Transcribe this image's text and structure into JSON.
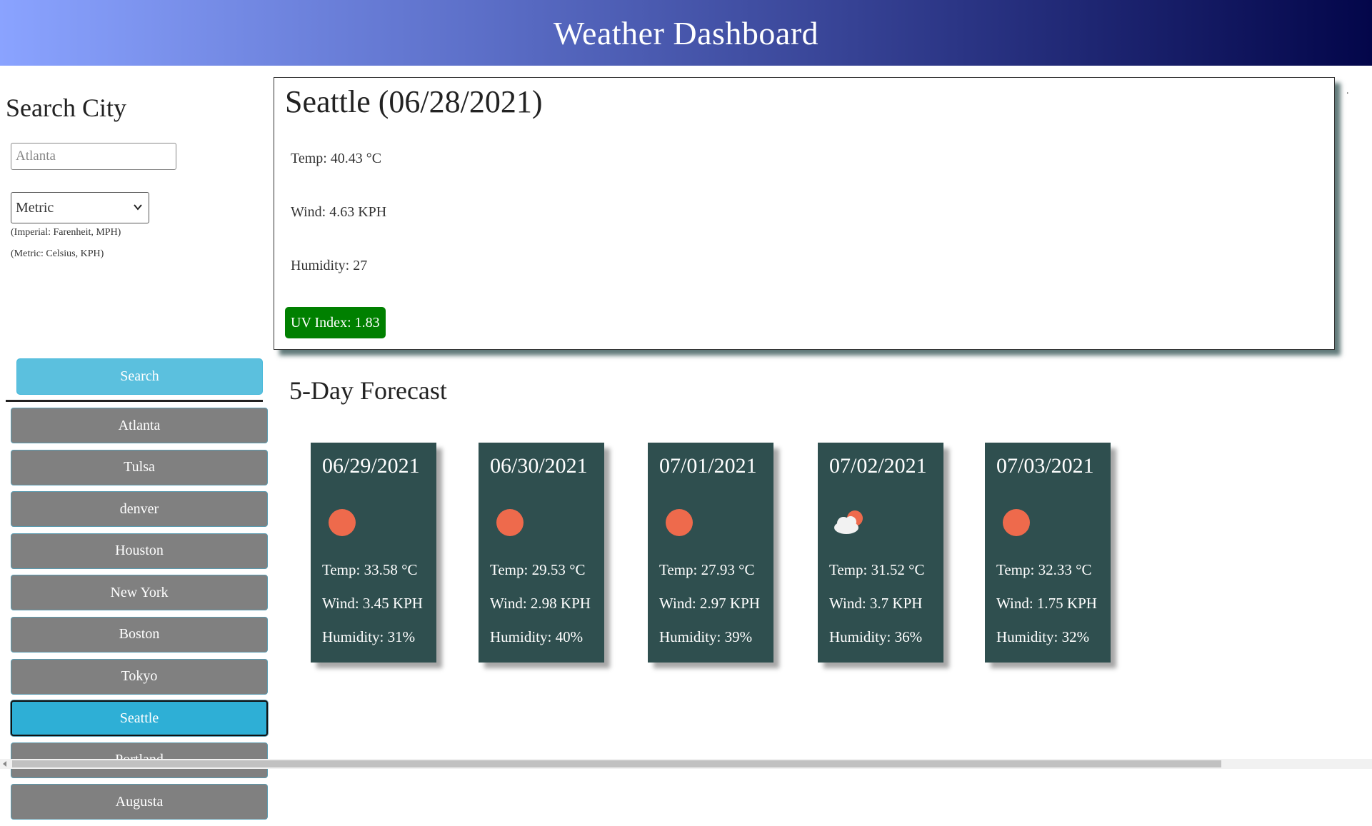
{
  "header": {
    "title": "Weather Dashboard"
  },
  "sidebar": {
    "title": "Search City",
    "search_input": {
      "placeholder": "Atlanta",
      "value": ""
    },
    "unit_select": {
      "selected": "Metric",
      "icon": "chevron-down-icon"
    },
    "hint_imperial": "(Imperial: Farenheit, MPH)",
    "hint_metric": "(Metric: Celsius, KPH)",
    "search_button": "Search",
    "history": [
      {
        "label": "Atlanta"
      },
      {
        "label": "Tulsa"
      },
      {
        "label": "denver"
      },
      {
        "label": "Houston"
      },
      {
        "label": "New York"
      },
      {
        "label": "Boston"
      },
      {
        "label": "Tokyo"
      },
      {
        "label": "Seattle",
        "active": true
      },
      {
        "label": "Portland"
      },
      {
        "label": "Augusta"
      }
    ]
  },
  "current": {
    "heading": "Seattle (06/28/2021)",
    "temp": "Temp: 40.43 °C",
    "wind": "Wind: 4.63 KPH",
    "humidity": "Humidity: 27",
    "uv": "UV Index: 1.83",
    "uv_color": "#008000"
  },
  "stray_mark": ".",
  "forecast": {
    "title": "5-Day Forecast",
    "days": [
      {
        "date": "06/29/2021",
        "icon": "sun-icon",
        "temp": "Temp: 33.58 °C",
        "wind": "Wind: 3.45 KPH",
        "humidity": "Humidity: 31%"
      },
      {
        "date": "06/30/2021",
        "icon": "sun-icon",
        "temp": "Temp: 29.53 °C",
        "wind": "Wind: 2.98 KPH",
        "humidity": "Humidity: 40%"
      },
      {
        "date": "07/01/2021",
        "icon": "sun-icon",
        "temp": "Temp: 27.93 °C",
        "wind": "Wind: 2.97 KPH",
        "humidity": "Humidity: 39%"
      },
      {
        "date": "07/02/2021",
        "icon": "partly-cloudy-icon",
        "temp": "Temp: 31.52 °C",
        "wind": "Wind: 3.7 KPH",
        "humidity": "Humidity: 36%"
      },
      {
        "date": "07/03/2021",
        "icon": "sun-icon",
        "temp": "Temp: 32.33 °C",
        "wind": "Wind: 1.75 KPH",
        "humidity": "Humidity: 32%"
      }
    ]
  },
  "colors": {
    "card_bg": "#2f4f4f",
    "search_button": "#5bc0de",
    "history_button": "#808080",
    "active_history": "#2eafd6",
    "sun": "#ee6a4c"
  }
}
